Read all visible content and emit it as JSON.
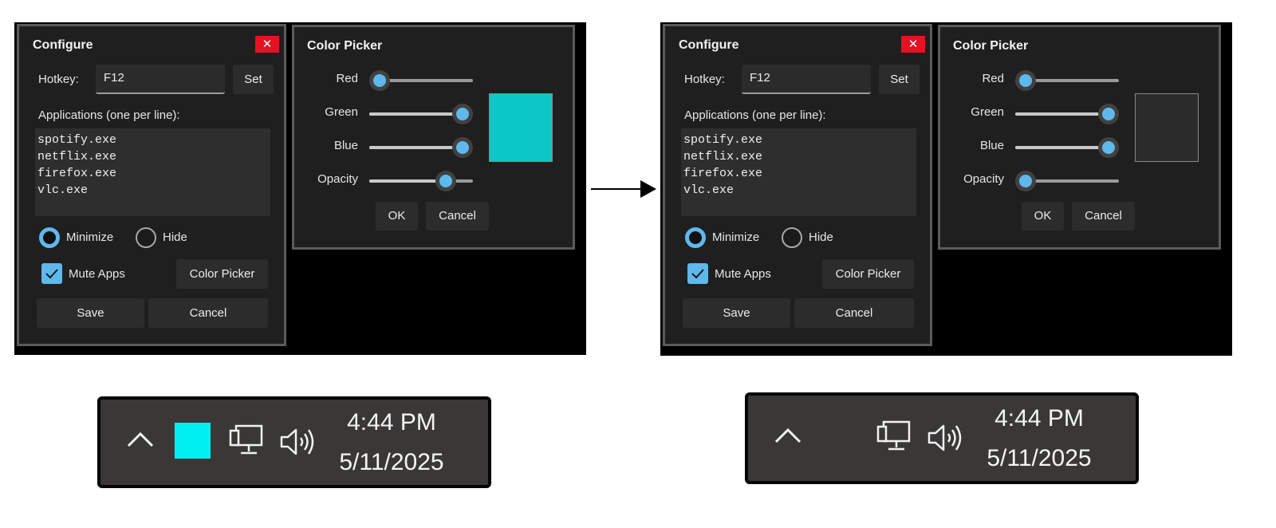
{
  "panels": [
    {
      "configure": {
        "title": "Configure",
        "close_glyph": "✕",
        "hotkey_label": "Hotkey:",
        "hotkey_value": "F12",
        "set_label": "Set",
        "apps_label": "Applications (one per line):",
        "apps": [
          "spotify.exe",
          "netflix.exe",
          "firefox.exe",
          "vlc.exe"
        ],
        "minimize_label": "Minimize",
        "hide_label": "Hide",
        "selected_mode": "Minimize",
        "mute_label": "Mute Apps",
        "mute_checked": true,
        "color_picker_label": "Color Picker",
        "save_label": "Save",
        "cancel_label": "Cancel"
      },
      "color_picker": {
        "title": "Color Picker",
        "sliders": [
          {
            "label": "Red",
            "value": 0.0
          },
          {
            "label": "Green",
            "value": 1.0
          },
          {
            "label": "Blue",
            "value": 1.0
          },
          {
            "label": "Opacity",
            "value": 0.8
          }
        ],
        "preview_color": "#0cc7c7",
        "ok_label": "OK",
        "cancel_label": "Cancel"
      },
      "tray": {
        "time": "4:44 PM",
        "date": "5/11/2025",
        "indicator_visible": true,
        "indicator_color": "#00f0f0",
        "icons": [
          "chevron-up-icon",
          "network-icon",
          "volume-icon"
        ]
      }
    },
    {
      "configure": {
        "title": "Configure",
        "close_glyph": "✕",
        "hotkey_label": "Hotkey:",
        "hotkey_value": "F12",
        "set_label": "Set",
        "apps_label": "Applications (one per line):",
        "apps": [
          "spotify.exe",
          "netflix.exe",
          "firefox.exe",
          "vlc.exe"
        ],
        "minimize_label": "Minimize",
        "hide_label": "Hide",
        "selected_mode": "Minimize",
        "mute_label": "Mute Apps",
        "mute_checked": true,
        "color_picker_label": "Color Picker",
        "save_label": "Save",
        "cancel_label": "Cancel"
      },
      "color_picker": {
        "title": "Color Picker",
        "sliders": [
          {
            "label": "Red",
            "value": 0.0
          },
          {
            "label": "Green",
            "value": 1.0
          },
          {
            "label": "Blue",
            "value": 1.0
          },
          {
            "label": "Opacity",
            "value": 0.0
          }
        ],
        "preview_color": "#2b2b2b",
        "ok_label": "OK",
        "cancel_label": "Cancel"
      },
      "tray": {
        "time": "4:44 PM",
        "date": "5/11/2025",
        "indicator_visible": false,
        "indicator_color": "#00f0f0",
        "icons": [
          "chevron-up-icon",
          "network-icon",
          "volume-icon"
        ]
      }
    }
  ],
  "colors": {
    "accent": "#5fb8ec",
    "close": "#e81123",
    "window_bg": "#1f1f1f",
    "tray_bg": "#3a3836"
  }
}
